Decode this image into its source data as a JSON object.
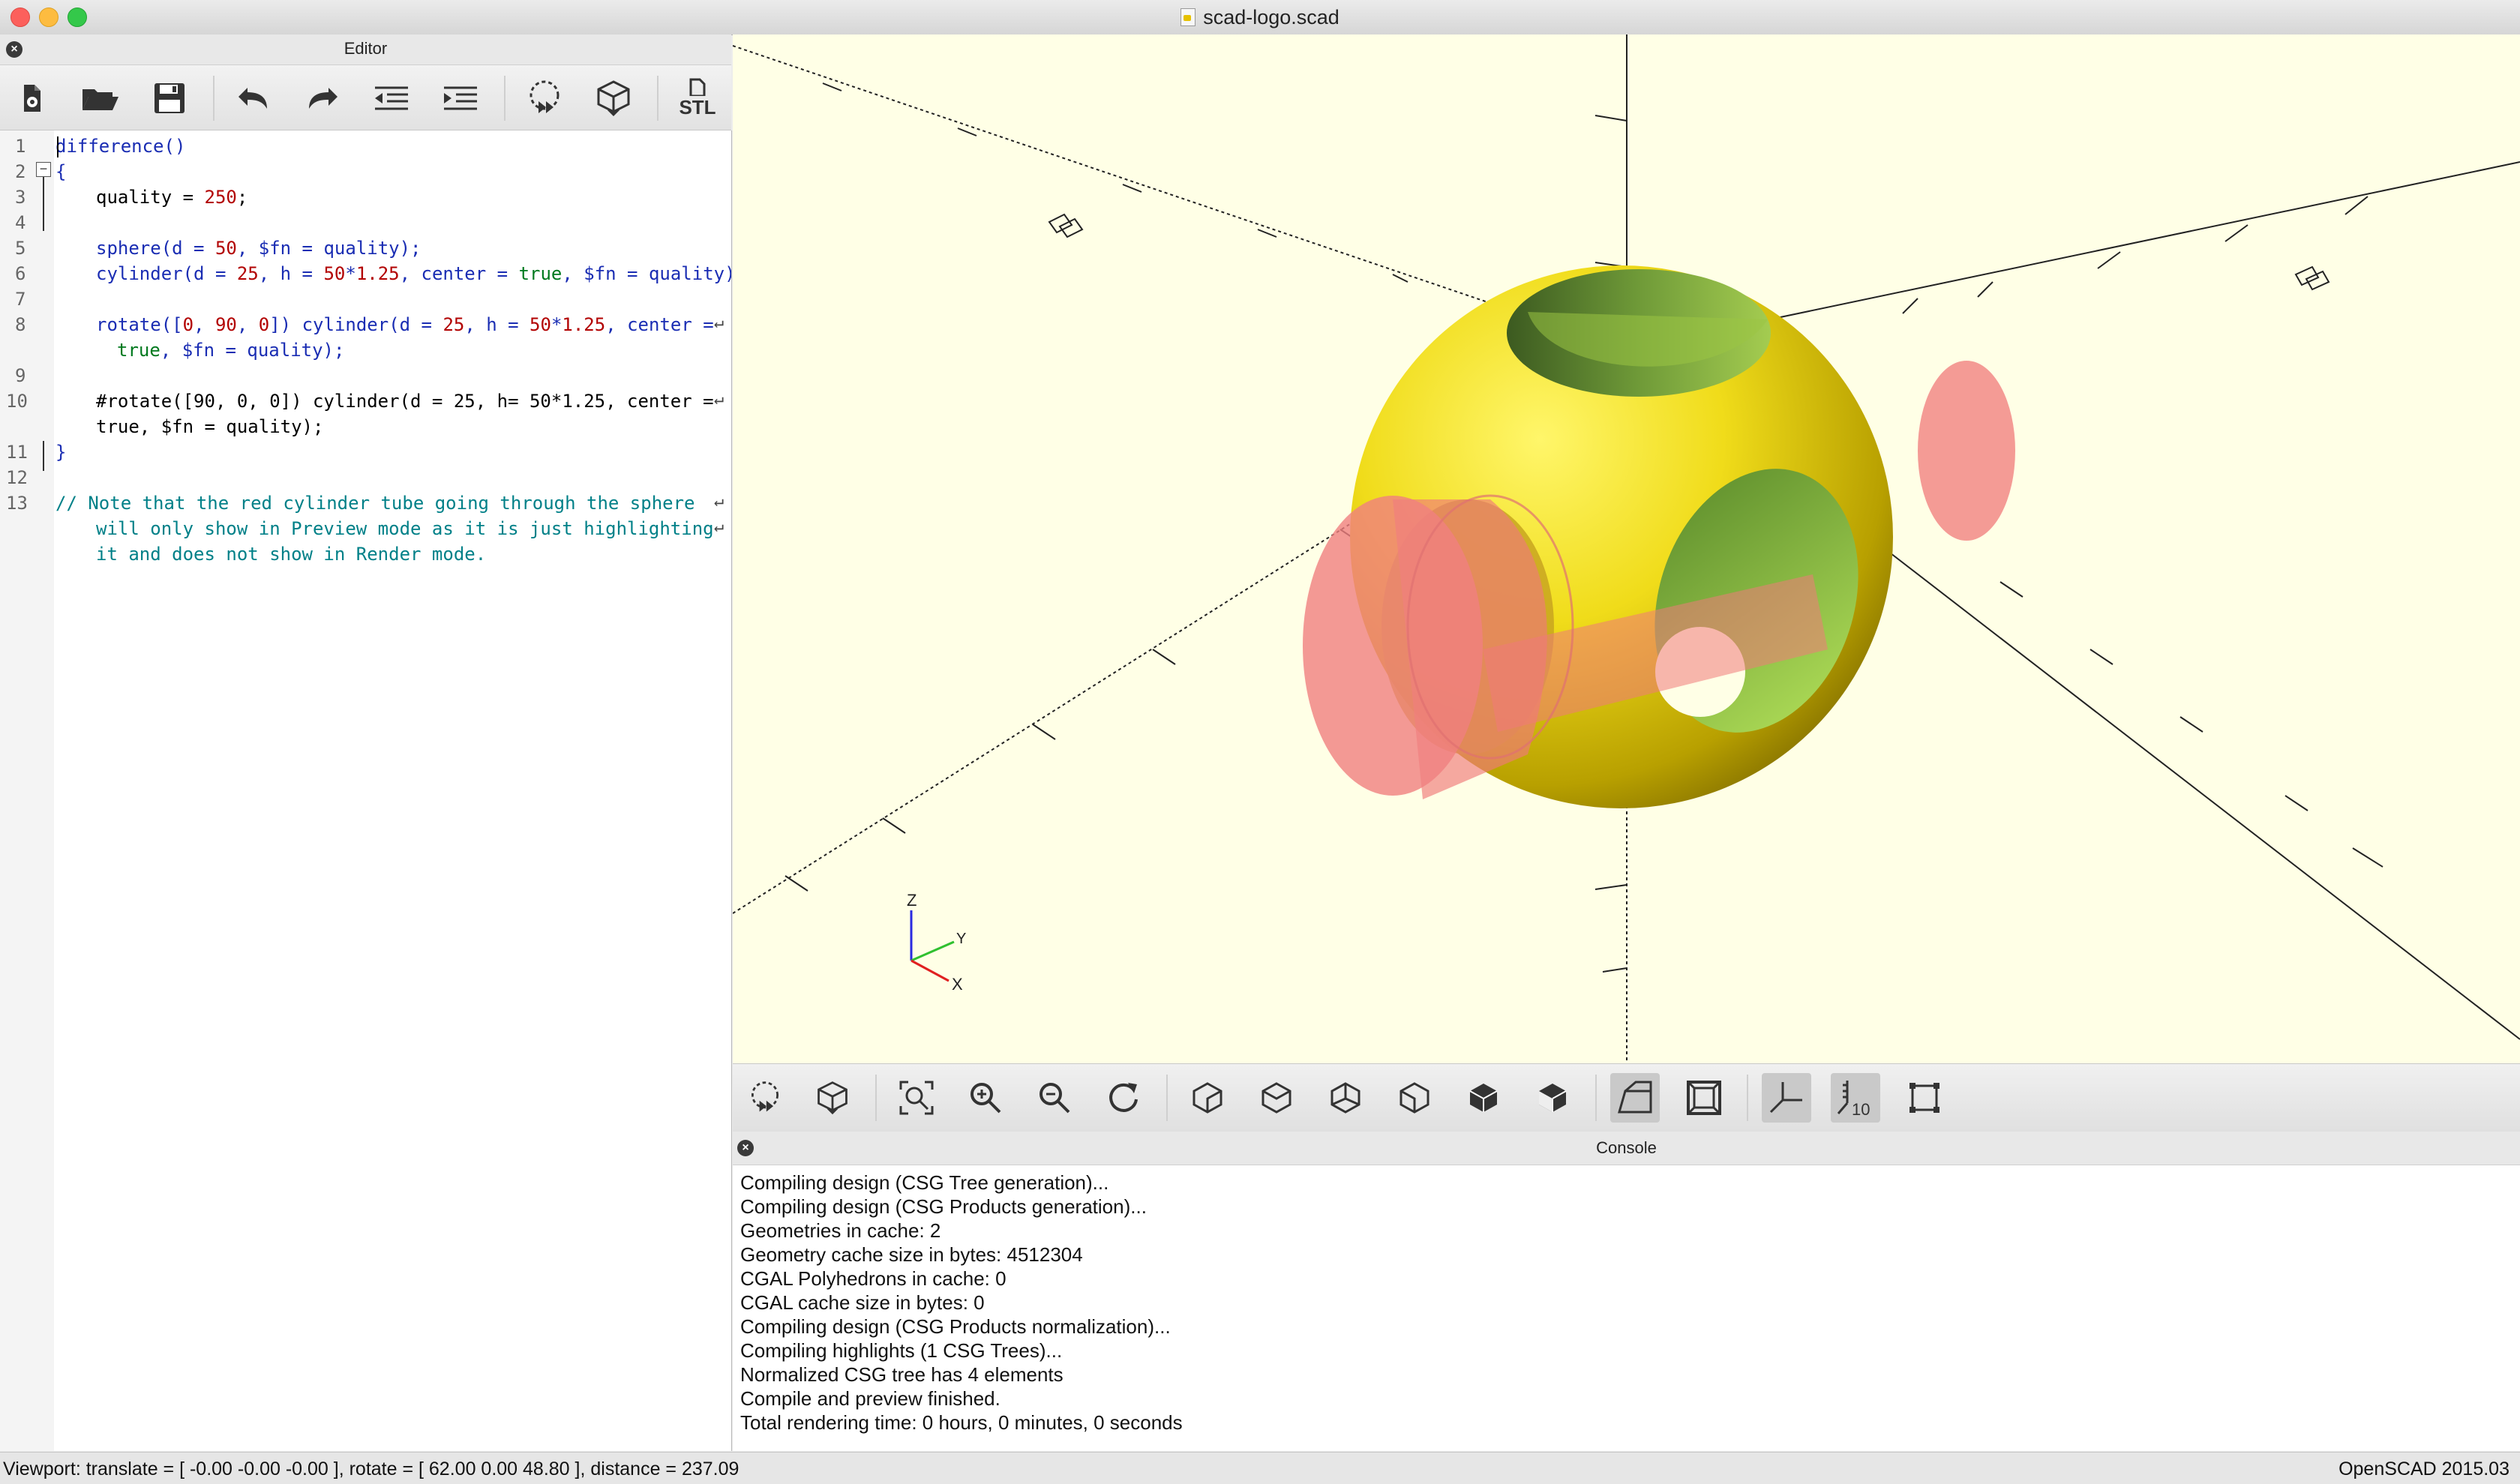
{
  "window": {
    "title": "scad-logo.scad"
  },
  "editor": {
    "title": "Editor",
    "toolbar": {
      "buttons": [
        "new-file-icon",
        "open-file-icon",
        "save-icon",
        "undo-icon",
        "redo-icon",
        "unindent-icon",
        "indent-icon",
        "preview-icon",
        "render-icon",
        "export-stl-icon"
      ],
      "stl_label": "STL"
    },
    "line_numbers": [
      "1",
      "2",
      "3",
      "4",
      "5",
      "6",
      "7",
      "8",
      "9",
      "10",
      "11",
      "12",
      "13"
    ],
    "code": {
      "l1_fn": "difference",
      "l1_paren": "()",
      "l2": "{",
      "l3_a": "quality = ",
      "l3_num": "250",
      "l3_end": ";",
      "l5_fn": "sphere",
      "l5_a": "(d = ",
      "l5_n1": "50",
      "l5_b": ", $fn = quality);",
      "l6_fn": "cylinder",
      "l6_a": "(d = ",
      "l6_n1": "25",
      "l6_b": ", h = ",
      "l6_n2": "50",
      "l6_c": "*",
      "l6_n3": "1.25",
      "l6_d": ", center = ",
      "l6_bool": "true",
      "l6_e": ", $fn = quality);",
      "l8_fn": "rotate",
      "l8_a": "([",
      "l8_n1": "0",
      "l8_b": ", ",
      "l8_n2": "90",
      "l8_c": ", ",
      "l8_n3": "0",
      "l8_d": "]) ",
      "l8_fn2": "cylinder",
      "l8_e": "(d = ",
      "l8_n4": "25",
      "l8_f": ", h = ",
      "l8_n5": "50",
      "l8_g": "*",
      "l8_n6": "1.25",
      "l8_h": ", center = ",
      "l8w_bool": "true",
      "l8w_rest": ", $fn = quality);",
      "l10": "#rotate([90, 0, 0]) cylinder(d = 25, h= 50*1.25, center = ",
      "l10w": "true, $fn = quality);",
      "l11": "}",
      "l13": "// Note that the red cylinder tube going through the sphere",
      "l13w1": "will only show in Preview mode as it is just highlighting",
      "l13w2": "it and does not show in Render mode."
    }
  },
  "viewport": {
    "axis_labels": {
      "z": "Z",
      "y": "Y",
      "x": "X"
    },
    "colors": {
      "background": "#ffffe6",
      "sphere": "#f2e21e",
      "highlight": "#f07a7a",
      "cut_face": "#9ccc3c"
    }
  },
  "view_toolbar": {
    "buttons": [
      "preview-icon",
      "render-icon",
      "view-all-icon",
      "zoom-in-icon",
      "zoom-out-icon",
      "reset-view-icon",
      "view-right-icon",
      "view-top-icon",
      "view-bottom-icon",
      "view-left-icon",
      "view-front-icon",
      "view-back-icon",
      "perspective-icon",
      "orthogonal-icon",
      "show-axes-icon",
      "show-scale-icon",
      "show-edges-icon"
    ],
    "scale_label": "10"
  },
  "console": {
    "title": "Console",
    "lines": [
      "Compiling design (CSG Tree generation)...",
      "Compiling design (CSG Products generation)...",
      "Geometries in cache: 2",
      "Geometry cache size in bytes: 4512304",
      "CGAL Polyhedrons in cache: 0",
      "CGAL cache size in bytes: 0",
      "Compiling design (CSG Products normalization)...",
      "Compiling highlights (1 CSG Trees)...",
      "Normalized CSG tree has 4 elements",
      "Compile and preview finished.",
      "Total rendering time: 0 hours, 0 minutes, 0 seconds"
    ]
  },
  "status": {
    "viewport": "Viewport: translate = [ -0.00 -0.00 -0.00 ], rotate = [ 62.00 0.00 48.80 ], distance = 237.09",
    "version": "OpenSCAD 2015.03"
  }
}
